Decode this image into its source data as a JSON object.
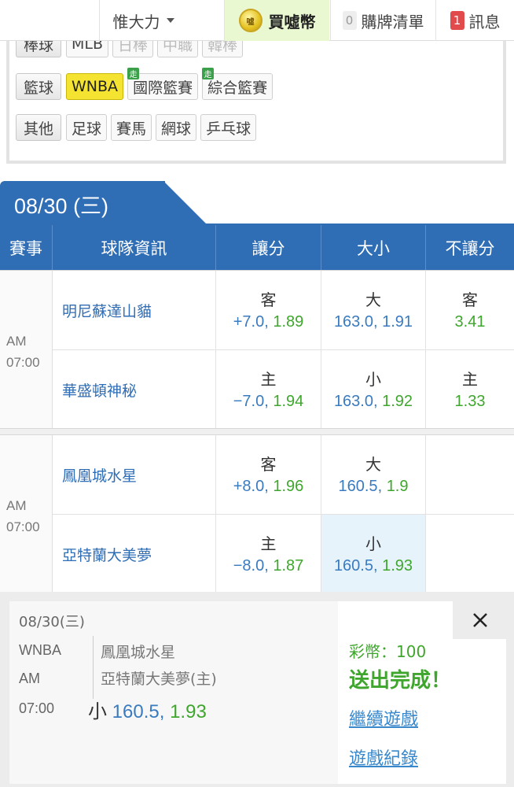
{
  "topbar": {
    "username": "惟大力",
    "buy_label": "買噓幣",
    "coin_icon_text": "噓",
    "cart_count": "0",
    "cart_label": "購牌清單",
    "msg_count": "1",
    "msg_label": "訊息"
  },
  "categories": {
    "baseball": {
      "label": "棒球",
      "items": [
        "MLB",
        "日棒",
        "中職",
        "韓棒"
      ]
    },
    "basketball": {
      "label": "籃球",
      "items": [
        "WNBA",
        "國際籃賽",
        "綜合籃賽"
      ],
      "live_badge": "走"
    },
    "other": {
      "label": "其他",
      "items": [
        "足球",
        "賽馬",
        "網球",
        "乒乓球"
      ]
    }
  },
  "date_tab": "08/30 (三)",
  "table_headers": [
    "賽事",
    "球隊資訊",
    "讓分",
    "大小",
    "不讓分"
  ],
  "games": [
    {
      "ampm": "AM",
      "time": "07:00",
      "rows": [
        {
          "team": "明尼蘇達山貓",
          "spread_side": "客",
          "spread": "+7.0",
          "spread_odds": "1.89",
          "total_side": "大",
          "total": "163.0",
          "total_odds": "1.91",
          "ml_side": "客",
          "ml_odds": "3.41"
        },
        {
          "team": "華盛頓神秘",
          "spread_side": "主",
          "spread": "−7.0",
          "spread_odds": "1.94",
          "total_side": "小",
          "total": "163.0",
          "total_odds": "1.92",
          "ml_side": "主",
          "ml_odds": "1.33"
        }
      ]
    },
    {
      "ampm": "AM",
      "time": "07:00",
      "rows": [
        {
          "team": "鳳凰城水星",
          "spread_side": "客",
          "spread": "+8.0",
          "spread_odds": "1.96",
          "total_side": "大",
          "total": "160.5",
          "total_odds": "1.9",
          "ml_side": "",
          "ml_odds": ""
        },
        {
          "team": "亞特蘭大美夢",
          "spread_side": "主",
          "spread": "−8.0",
          "spread_odds": "1.87",
          "total_side": "小",
          "total": "160.5",
          "total_odds": "1.93",
          "ml_side": "",
          "ml_odds": ""
        }
      ]
    }
  ],
  "slip": {
    "date": "08/30(三)",
    "league": "WNBA",
    "ampm": "AM",
    "time": "07:00",
    "team_away": "鳳凰城水星",
    "team_home": "亞特蘭大美夢(主)",
    "pick_side": "小",
    "pick_line": "160.5,",
    "pick_odds": "1.93",
    "coins": "彩幣：100",
    "status": "送出完成！",
    "continue_link": "繼續遊戲",
    "history_link": "遊戲紀錄"
  },
  "colors": {
    "primary": "#2f6db5",
    "accent_green": "#3fa62d",
    "odds_blue": "#3a7bbf",
    "active_chip": "#f4e330"
  }
}
